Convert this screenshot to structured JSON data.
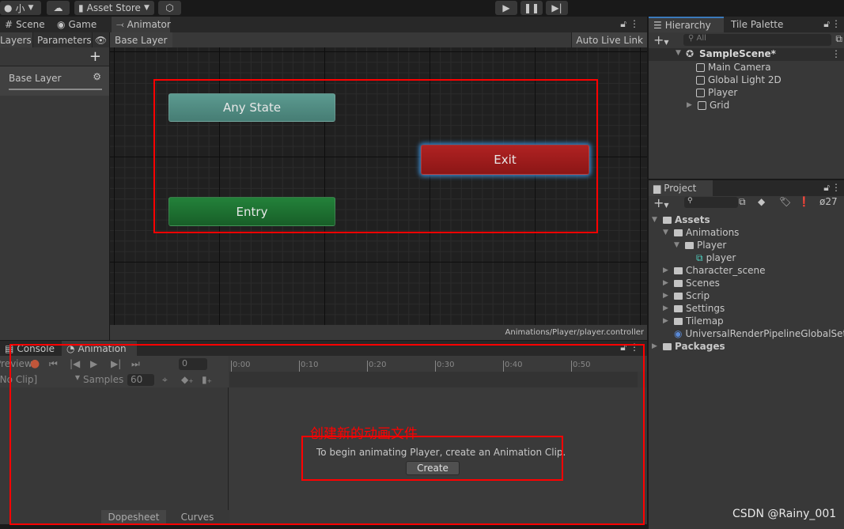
{
  "toolbar": {
    "account_label": "小",
    "asset_store": "Asset Store",
    "play_icon": "play-icon",
    "pause_icon": "pause-icon",
    "step_icon": "step-icon"
  },
  "scene_tabs": {
    "scene": "Scene",
    "game": "Game",
    "animator": "Animator"
  },
  "animator": {
    "layers_tab": "Layers",
    "parameters_tab": "Parameters",
    "breadcrumb": "Base Layer",
    "auto_live_link": "Auto Live Link",
    "layer_name": "Base Layer",
    "nodes": {
      "any_state": "Any State",
      "exit": "Exit",
      "entry": "Entry"
    },
    "path": "Animations/Player/player.controller"
  },
  "hierarchy": {
    "tab": "Hierarchy",
    "tile_palette": "Tile Palette",
    "search_placeholder": "All",
    "scene": "SampleScene*",
    "items": [
      "Main Camera",
      "Global Light 2D",
      "Player",
      "Grid"
    ]
  },
  "project": {
    "tab": "Project",
    "hidden_count": "27",
    "tree": {
      "assets": "Assets",
      "animations": "Animations",
      "player_folder": "Player",
      "player_controller": "player",
      "folders": [
        "Character_scene",
        "Scenes",
        "Scrip",
        "Settings",
        "Tilemap"
      ],
      "urp": "UniversalRenderPipelineGlobalSettings",
      "packages": "Packages"
    }
  },
  "bottom": {
    "console_tab": "Console",
    "animation_tab": "Animation"
  },
  "animation": {
    "preview": "Preview",
    "frame": "0",
    "clip": "[No Clip]",
    "samples_label": "Samples",
    "samples": "60",
    "ticks": [
      "0:00",
      "0:10",
      "0:20",
      "0:30",
      "0:40",
      "0:50"
    ],
    "message": "To begin animating Player, create an Animation Clip.",
    "create": "Create",
    "dopesheet": "Dopesheet",
    "curves": "Curves"
  },
  "annotation": {
    "text": "创建新的动画文件",
    "color": "#ff0000"
  },
  "watermark": "CSDN @Rainy_001",
  "colors": {
    "any_state": "#4f8b82",
    "exit": "#9e1b1b",
    "entry": "#1e7230",
    "accent": "#3a79bb"
  }
}
